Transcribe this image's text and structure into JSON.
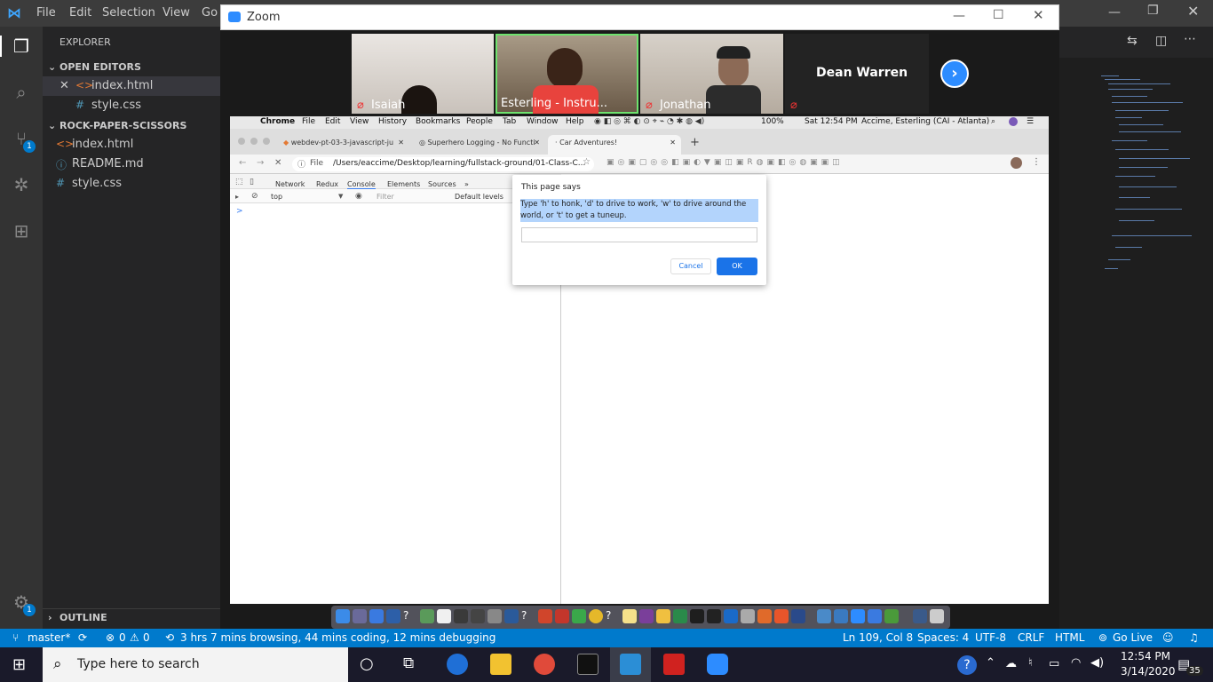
{
  "vscode": {
    "menu": [
      "File",
      "Edit",
      "Selection",
      "View",
      "Go"
    ],
    "explorer_title": "EXPLORER",
    "open_editors_title": "OPEN EDITORS",
    "open_editors": [
      {
        "name": "index.html",
        "icon": "html-icon"
      },
      {
        "name": "style.css",
        "icon": "css-icon"
      }
    ],
    "project_title": "ROCK-PAPER-SCISSORS",
    "project_files": [
      {
        "name": "index.html",
        "icon": "html-icon"
      },
      {
        "name": "README.md",
        "icon": "info-icon"
      },
      {
        "name": "style.css",
        "icon": "css-icon"
      }
    ],
    "outline_title": "OUTLINE",
    "scm_badge": "1",
    "settings_badge": "1",
    "status": {
      "branch": "master*",
      "errors": "0",
      "warnings": "0",
      "time_tracking": "3 hrs 7 mins browsing, 44 mins coding, 12 mins debugging",
      "position": "Ln 109, Col 8",
      "spaces": "Spaces: 4",
      "encoding": "UTF-8",
      "eol": "CRLF",
      "language": "HTML",
      "go_live": "Go Live"
    }
  },
  "zoom": {
    "title": "Zoom",
    "participants": [
      {
        "name": "Isaiah",
        "muted": true
      },
      {
        "name": "Esterling - Instru...",
        "muted": false
      },
      {
        "name": "Jonathan",
        "muted": true
      },
      {
        "name": "Dean Warren",
        "muted": true
      }
    ]
  },
  "mac": {
    "menubar": [
      "Chrome",
      "File",
      "Edit",
      "View",
      "History",
      "Bookmarks",
      "People",
      "Tab",
      "Window",
      "Help"
    ],
    "battery": "100%",
    "clock": "Sat 12:54 PM",
    "user": "Accime, Esterling (CAI - Atlanta)"
  },
  "chrome": {
    "tabs": [
      {
        "title": "webdev-pt-03-3-javascript-ju"
      },
      {
        "title": "Superhero Logging - No Functi"
      },
      {
        "title": "Car Adventures!"
      }
    ],
    "address_scheme": "File",
    "address_path": "/Users/eaccime/Desktop/learning/fullstack-ground/01-Class-C...",
    "devtools_tabs": [
      "Network",
      "Redux",
      "Console",
      "Elements",
      "Sources"
    ],
    "devtools_more": "»",
    "context": "top",
    "filter_placeholder": "Filter",
    "levels": "Default levels",
    "prompt": ">"
  },
  "dialog": {
    "title": "This page says",
    "message": "Type 'h' to honk, 'd' to drive to work, 'w' to drive around the world, or 't' to get a tuneup.",
    "input_value": "",
    "cancel": "Cancel",
    "ok": "OK"
  },
  "taskbar": {
    "search_placeholder": "Type here to search",
    "time": "12:54 PM",
    "date": "3/14/2020",
    "notifications": "35"
  },
  "colors": {
    "vscode_blue": "#007acc",
    "chrome_blue": "#1a73e8",
    "zoom_blue": "#2d8cff"
  }
}
